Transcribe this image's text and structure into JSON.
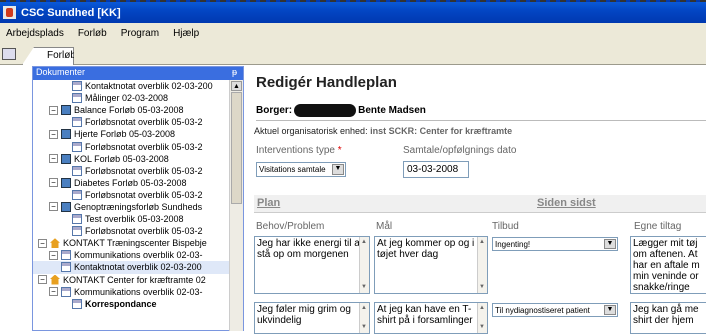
{
  "window": {
    "title": "CSC Sundhed [KK]"
  },
  "menu": [
    "Arbejdsplads",
    "Forløb",
    "Program",
    "Hjælp"
  ],
  "tab": {
    "label": "Forløb"
  },
  "left_panel": {
    "title": "Dokumenter",
    "pin": "ᵽ",
    "tree": [
      {
        "indent": 3,
        "icon": "doc",
        "label": "Kontaktnotat overblik 02-03-200"
      },
      {
        "indent": 3,
        "icon": "doc",
        "label": "Målinger 02-03-2008"
      },
      {
        "indent": 2,
        "icon": "fold",
        "exp": "−",
        "label": "Balance Forløb 05-03-2008"
      },
      {
        "indent": 3,
        "icon": "doc",
        "label": "Forløbsnotat overblik 05-03-2"
      },
      {
        "indent": 2,
        "icon": "fold",
        "exp": "−",
        "label": "Hjerte Forløb 05-03-2008"
      },
      {
        "indent": 3,
        "icon": "doc",
        "label": "Forløbsnotat overblik 05-03-2"
      },
      {
        "indent": 2,
        "icon": "fold",
        "exp": "−",
        "label": "KOL Forløb 05-03-2008"
      },
      {
        "indent": 3,
        "icon": "doc",
        "label": "Forløbsnotat overblik 05-03-2"
      },
      {
        "indent": 2,
        "icon": "fold",
        "exp": "−",
        "label": "Diabetes Forløb 05-03-2008"
      },
      {
        "indent": 3,
        "icon": "doc",
        "label": "Forløbsnotat overblik 05-03-2"
      },
      {
        "indent": 2,
        "icon": "fold",
        "exp": "−",
        "label": "Genoptræningsforløb Sundheds"
      },
      {
        "indent": 3,
        "icon": "doc",
        "label": "Test overblik 05-03-2008"
      },
      {
        "indent": 3,
        "icon": "doc",
        "label": "Forløbsnotat overblik 05-03-2"
      },
      {
        "indent": 1,
        "icon": "house",
        "exp": "−",
        "label": "KONTAKT Træningscenter Bispebje"
      },
      {
        "indent": 2,
        "icon": "doc",
        "exp": "−",
        "label": "Kommunikations overblik 02-03-"
      },
      {
        "indent": 2,
        "icon": "doc",
        "label": "Kontaktnotat overblik 02-03-200",
        "selected": true
      },
      {
        "indent": 1,
        "icon": "house",
        "exp": "−",
        "label": "KONTAKT Center for kræftramte 02"
      },
      {
        "indent": 2,
        "icon": "doc",
        "exp": "−",
        "label": "Kommunikations overblik 02-03-"
      },
      {
        "indent": 3,
        "icon": "doc",
        "label": "Korrespondance",
        "bold": true
      }
    ]
  },
  "form": {
    "title": "Redigér Handleplan",
    "borger_label": "Borger:",
    "borger_name": "Bente Madsen",
    "org_label": "Aktuel organisatorisk enhed:",
    "org_value": "inst SCKR: Center for kræftramte",
    "intervention_label": "Interventions type",
    "required_mark": "*",
    "intervention_value": "Visitations samtale",
    "followup_label": "Samtale/opfølgnings dato",
    "followup_value": "03-03-2008",
    "section_plan": "Plan",
    "section_since": "Siden sidst",
    "columns": [
      "Behov/Problem",
      "Mål",
      "Tilbud",
      "Egne tiltag"
    ],
    "rows": [
      {
        "behov": "Jeg har ikke energi til at stå op om morgenen",
        "maal": "At jeg kommer op og i tøjet hver dag",
        "tilbud": "Ingenting!",
        "egne": "Lægger mit tøj om aftenen. At har en aftale m min veninde or snakke/ringe"
      },
      {
        "behov": "Jeg føler mig grim og ukvindelig",
        "maal": "At jeg kan have en T-shirt på i forsamlinger",
        "tilbud": "Til nydiagnostiseret patient",
        "egne": "Jeg kan gå me shirt der hjem"
      }
    ]
  }
}
